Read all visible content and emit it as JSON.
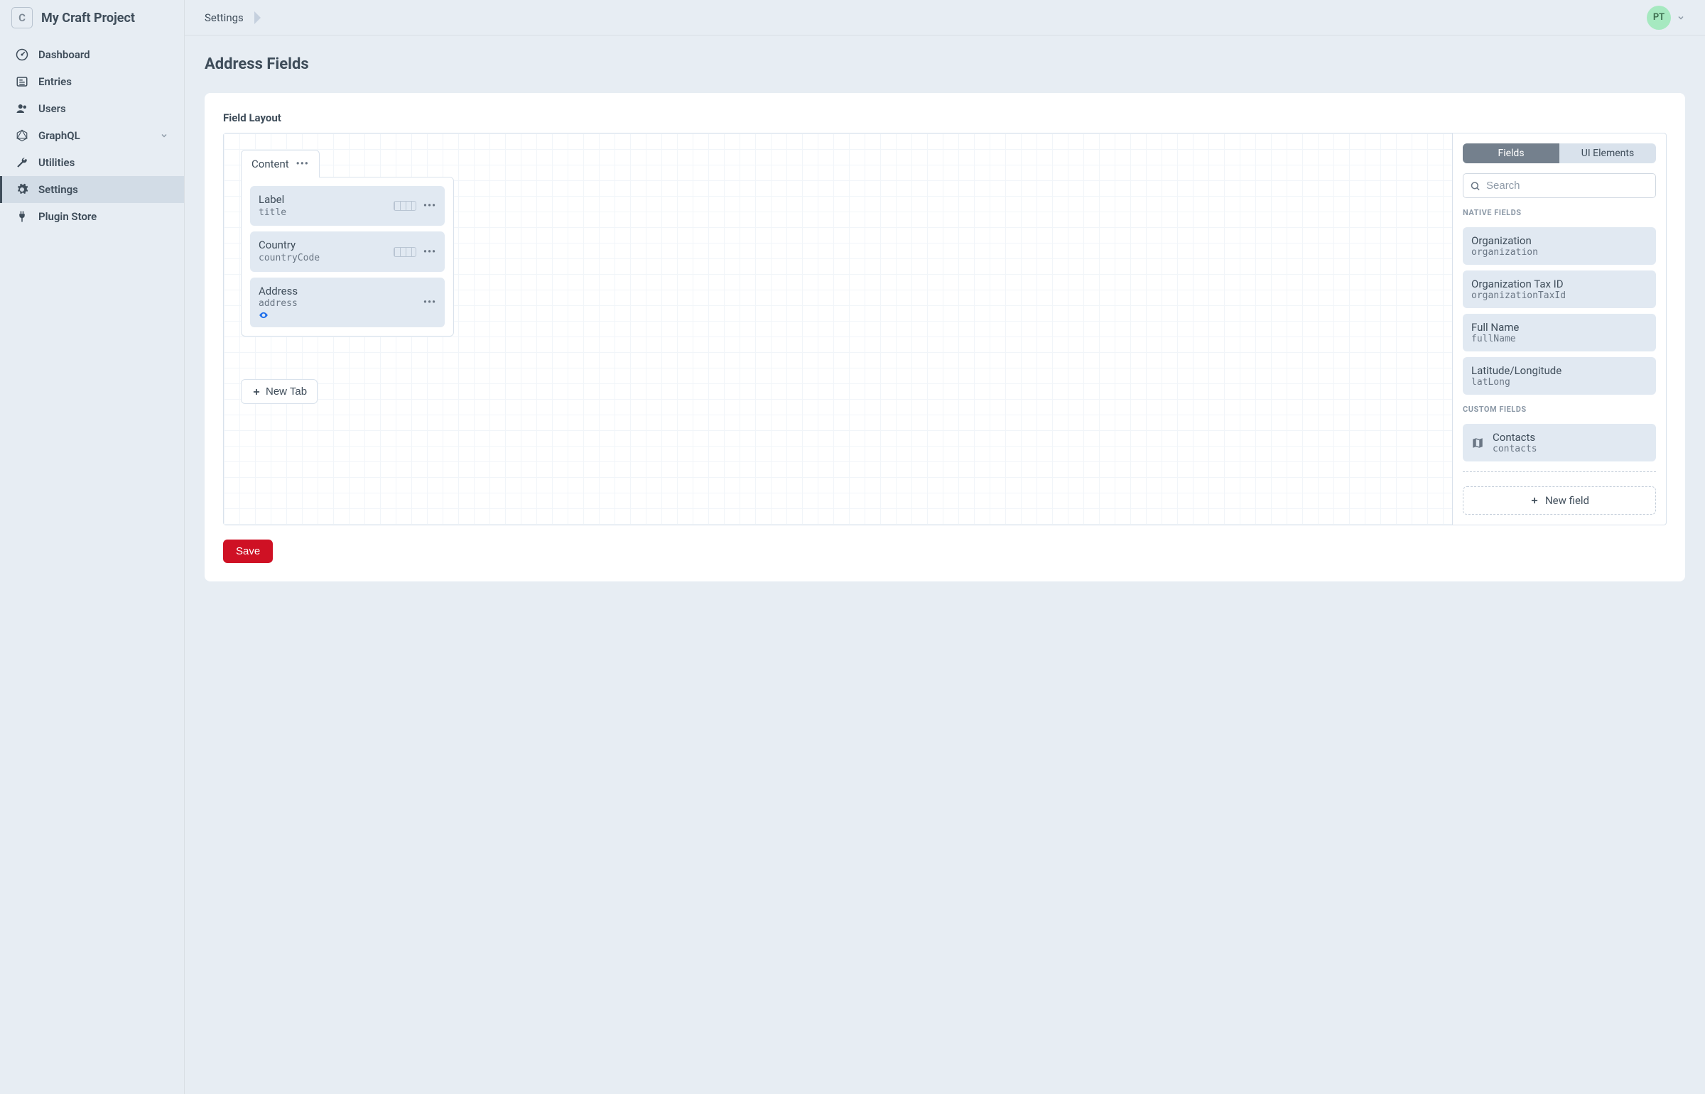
{
  "app": {
    "logo_letter": "C",
    "project_name": "My Craft Project"
  },
  "sidebar": {
    "items": [
      {
        "label": "Dashboard",
        "icon": "gauge-icon"
      },
      {
        "label": "Entries",
        "icon": "newspaper-icon"
      },
      {
        "label": "Users",
        "icon": "users-icon"
      },
      {
        "label": "GraphQL",
        "icon": "graphql-icon",
        "chevron": true
      },
      {
        "label": "Utilities",
        "icon": "wrench-icon"
      },
      {
        "label": "Settings",
        "icon": "gear-icon",
        "active": true
      },
      {
        "label": "Plugin Store",
        "icon": "plug-icon"
      }
    ]
  },
  "header": {
    "breadcrumb": "Settings",
    "user_initials": "PT"
  },
  "page": {
    "title": "Address Fields",
    "panel_heading": "Field Layout",
    "tab": {
      "name": "Content",
      "fields": [
        {
          "label": "Label",
          "handle": "title",
          "has_width": true,
          "has_eye": false
        },
        {
          "label": "Country",
          "handle": "countryCode",
          "has_width": true,
          "has_eye": false
        },
        {
          "label": "Address",
          "handle": "address",
          "has_width": false,
          "has_eye": true
        }
      ]
    },
    "new_tab_label": "New Tab",
    "save_label": "Save"
  },
  "field_library": {
    "tabs": {
      "fields": "Fields",
      "ui": "UI Elements"
    },
    "search_placeholder": "Search",
    "native_label": "NATIVE FIELDS",
    "native": [
      {
        "label": "Organization",
        "handle": "organization"
      },
      {
        "label": "Organization Tax ID",
        "handle": "organizationTaxId"
      },
      {
        "label": "Full Name",
        "handle": "fullName"
      },
      {
        "label": "Latitude/Longitude",
        "handle": "latLong"
      }
    ],
    "custom_label": "CUSTOM FIELDS",
    "custom": [
      {
        "label": "Contacts",
        "handle": "contacts",
        "icon": "map-icon"
      }
    ],
    "new_field_label": "New field"
  }
}
